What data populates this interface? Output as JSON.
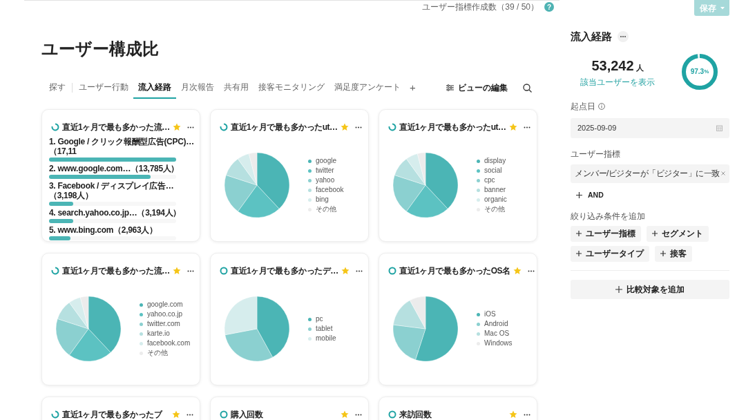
{
  "header": {
    "usage_text": "ユーザー指標作成数（39 / 50）",
    "help": "?",
    "save_button": "保存"
  },
  "page_title": "ユーザー構成比",
  "tabs": [
    {
      "label": "探す",
      "selected": false
    },
    {
      "label": "ユーザー行動",
      "selected": false
    },
    {
      "label": "流入経路",
      "selected": true
    },
    {
      "label": "月次報告",
      "selected": false
    },
    {
      "label": "共有用",
      "selected": false
    },
    {
      "label": "接客モニタリング",
      "selected": false
    },
    {
      "label": "満足度アンケート",
      "selected": false
    }
  ],
  "add_tab": "+",
  "edit_view": "ビューの編集",
  "cards": [
    {
      "kind": "ranking",
      "loading": true,
      "title": "直近1ヶ月で最も多かった流…",
      "rows": [
        {
          "label": "1. Google / クリック報酬型広告(CPC)…（17,11",
          "level": 1.0
        },
        {
          "label": "2. www.google.com…（13,785人）",
          "level": 0.8
        },
        {
          "label": "3. Facebook / ディスプレイ広告…（3,198人）",
          "level": 0.19
        },
        {
          "label": "4. search.yahoo.co.jp…（3,194人）",
          "level": 0.19
        },
        {
          "label": "5. www.bing.com（2,963人）",
          "level": 0.17
        }
      ]
    },
    {
      "kind": "pie",
      "loading": true,
      "title": "直近1ヶ月で最も多かったut…",
      "legend": [
        {
          "label": "google",
          "color": "#4bb5b5"
        },
        {
          "label": "twitter",
          "color": "#5cc2c2"
        },
        {
          "label": "yahoo",
          "color": "#8bd0d0"
        },
        {
          "label": "facebook",
          "color": "#b6e0e0"
        },
        {
          "label": "bing",
          "color": "#d6eded"
        },
        {
          "label": "その他",
          "color": "#ececec"
        }
      ]
    },
    {
      "kind": "pie",
      "loading": true,
      "title": "直近1ヶ月で最も多かったut…",
      "legend": [
        {
          "label": "display",
          "color": "#4bb5b5"
        },
        {
          "label": "social",
          "color": "#5cc2c2"
        },
        {
          "label": "cpc",
          "color": "#8bd0d0"
        },
        {
          "label": "banner",
          "color": "#b6e0e0"
        },
        {
          "label": "organic",
          "color": "#d6eded"
        },
        {
          "label": "その他",
          "color": "#ececec"
        }
      ]
    },
    {
      "kind": "pie",
      "loading": true,
      "title": "直近1ヶ月で最も多かった流…",
      "legend": [
        {
          "label": "google.com",
          "color": "#4bb5b5"
        },
        {
          "label": "yahoo.co.jp",
          "color": "#5cc2c2"
        },
        {
          "label": "twitter.com",
          "color": "#8bd0d0"
        },
        {
          "label": "karte.io",
          "color": "#b6e0e0"
        },
        {
          "label": "facebook.com",
          "color": "#d6eded"
        },
        {
          "label": "その他",
          "color": "#ececec"
        }
      ]
    },
    {
      "kind": "pie",
      "loading": false,
      "title": "直近1ヶ月で最も多かったデ…",
      "legend": [
        {
          "label": "pc",
          "color": "#4bb5b5"
        },
        {
          "label": "tablet",
          "color": "#8bd0d0"
        },
        {
          "label": "mobile",
          "color": "#d6eded"
        }
      ]
    },
    {
      "kind": "pie",
      "loading": false,
      "title": "直近1ヶ月で最も多かったOS名",
      "legend": [
        {
          "label": "iOS",
          "color": "#4bb5b5"
        },
        {
          "label": "Android",
          "color": "#8bd0d0"
        },
        {
          "label": "Mac OS",
          "color": "#b6e0e0"
        },
        {
          "label": "Windows",
          "color": "#ececec"
        }
      ]
    },
    {
      "kind": "cut",
      "loading": true,
      "title": "直近1ヶ月で最も多かったブ"
    },
    {
      "kind": "cut",
      "loading": false,
      "title": "購入回数"
    },
    {
      "kind": "cut",
      "loading": false,
      "title": "来訪回数"
    }
  ],
  "sidebar": {
    "title": "流入経路",
    "count": "53,242",
    "count_unit": "人",
    "show_users_link": "該当ユーザーを表示",
    "percent": "97.3",
    "percent_unit": "%",
    "level": 0.973,
    "start_date_label": "起点日",
    "start_date": "2025-09-09",
    "user_metric_label": "ユーザー指標",
    "condition": "メンバー/ビジターが「ビジター」に一致",
    "and_button": "AND",
    "filter_label": "絞り込み条件を追加",
    "filter_buttons": [
      "ユーザー指標",
      "セグメント",
      "ユーザータイプ",
      "接客"
    ],
    "compare_button": "比較対象を追加"
  }
}
